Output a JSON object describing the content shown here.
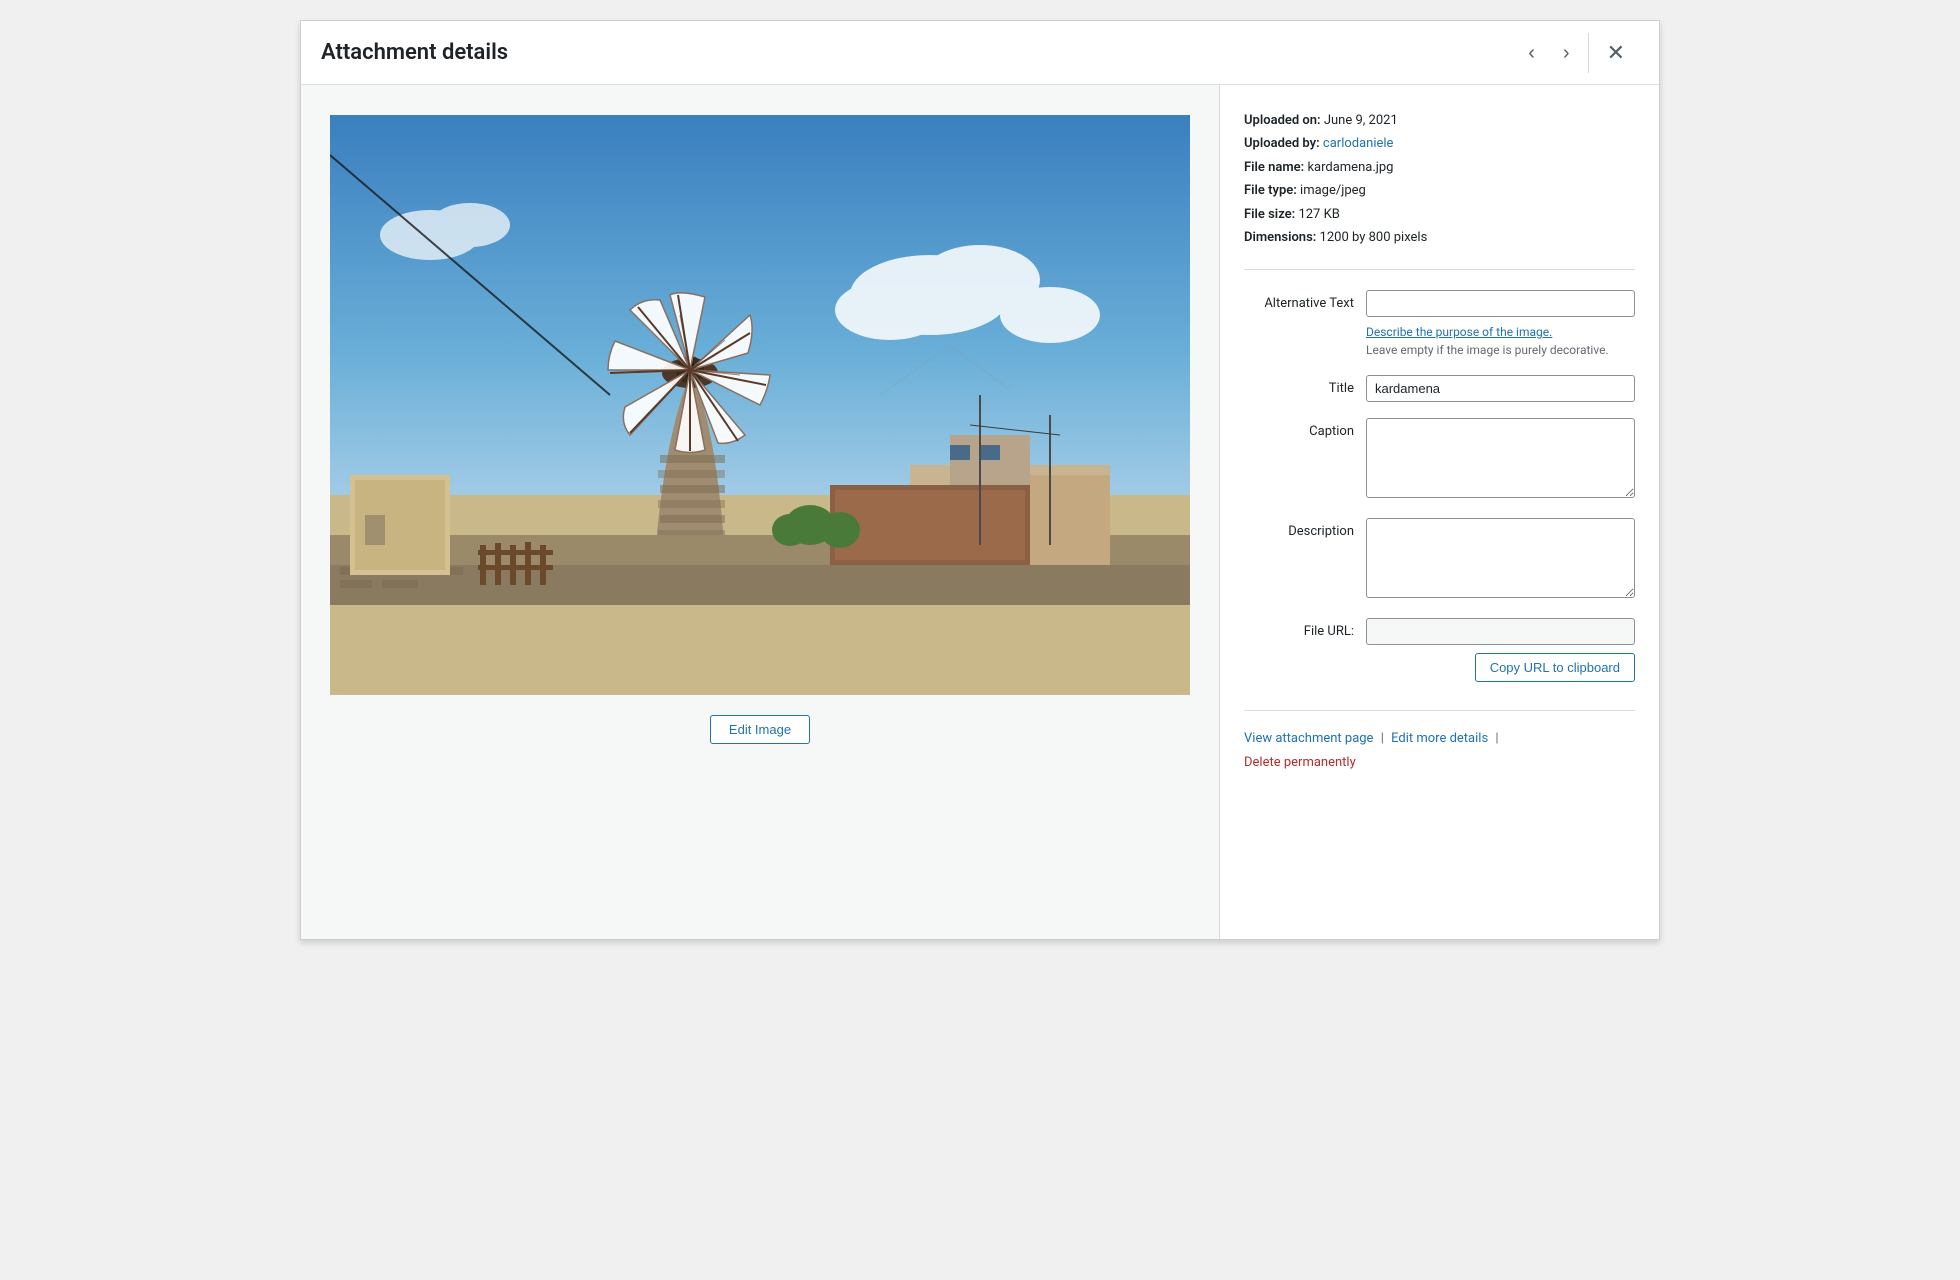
{
  "header": {
    "title": "Attachment details",
    "prev_label": "‹",
    "next_label": "›",
    "close_label": "✕"
  },
  "image": {
    "alt": "Windmill at Kardamena"
  },
  "edit_image_btn": "Edit Image",
  "meta": {
    "uploaded_on_label": "Uploaded on:",
    "uploaded_on_value": "June 9, 2021",
    "uploaded_by_label": "Uploaded by:",
    "uploaded_by_value": "carlodaniele",
    "file_name_label": "File name:",
    "file_name_value": "kardamena.jpg",
    "file_type_label": "File type:",
    "file_type_value": "image/jpeg",
    "file_size_label": "File size:",
    "file_size_value": "127 KB",
    "dimensions_label": "Dimensions:",
    "dimensions_value": "1200 by 800 pixels"
  },
  "form": {
    "alt_text_label": "Alternative Text",
    "alt_text_value": "",
    "alt_text_link": "Describe the purpose of the image.",
    "alt_text_hint": "Leave empty if the image is purely decorative.",
    "title_label": "Title",
    "title_value": "kardamena",
    "caption_label": "Caption",
    "caption_value": "",
    "description_label": "Description",
    "description_value": "",
    "file_url_label": "File URL:",
    "file_url_value": "",
    "copy_url_btn": "Copy URL to clipboard"
  },
  "footer": {
    "view_attachment_label": "View attachment page",
    "edit_more_label": "Edit more details",
    "delete_label": "Delete permanently"
  }
}
